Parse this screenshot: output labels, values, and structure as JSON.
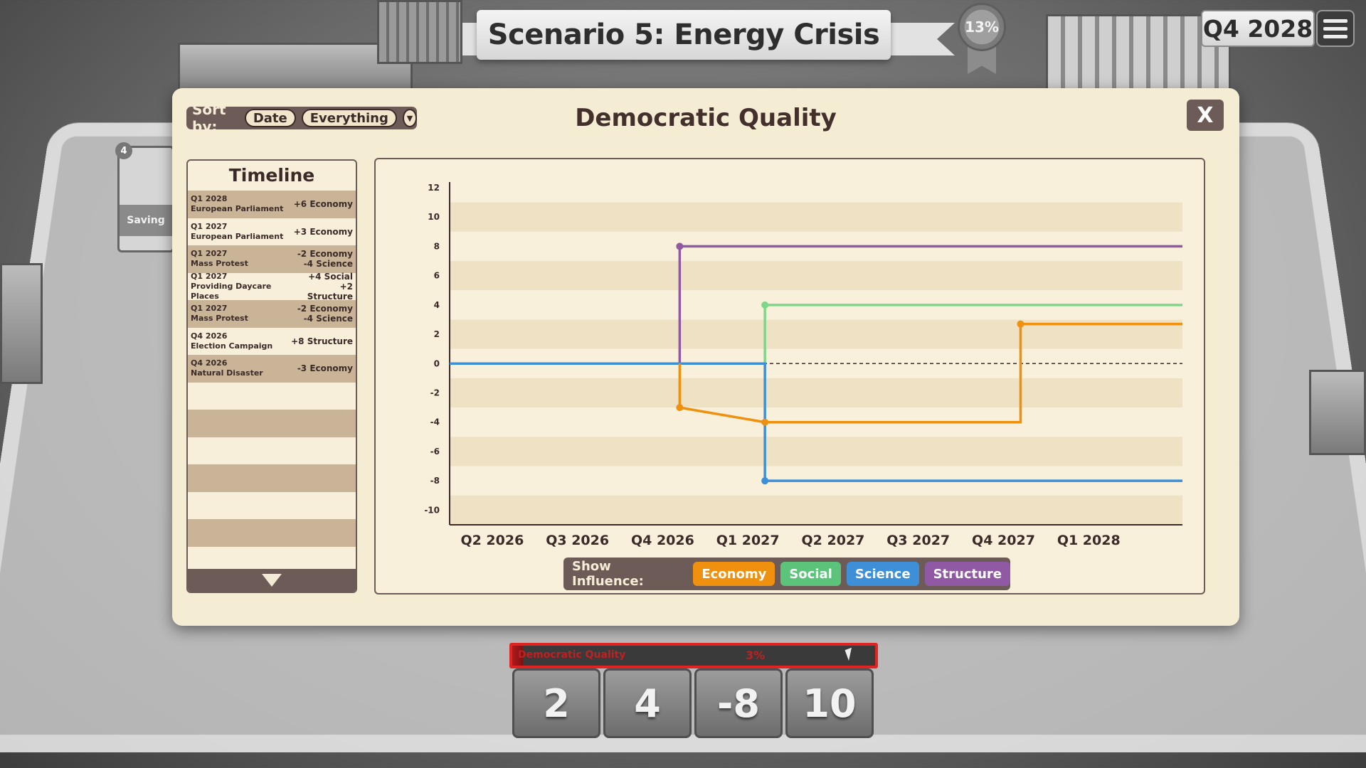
{
  "header": {
    "scenario_title": "Scenario 5: Energy Crisis",
    "progress_percent": "13%",
    "current_quarter": "Q4 2028"
  },
  "background": {
    "card_label": "Saving",
    "card_badge": "4"
  },
  "panel": {
    "title": "Democratic Quality",
    "sort_label": "Sort by:",
    "sort_primary": "Date",
    "sort_filter": "Everything",
    "close_label": "X"
  },
  "timeline": {
    "title": "Timeline",
    "entries": [
      {
        "quarter": "Q1 2028",
        "event": "European Parliament",
        "effect": "+6 Economy"
      },
      {
        "quarter": "Q1 2027",
        "event": "European Parliament",
        "effect": "+3 Economy"
      },
      {
        "quarter": "Q1 2027",
        "event": "Mass Protest",
        "effect": "-2 Economy\n-4 Science"
      },
      {
        "quarter": "Q1 2027",
        "event": "Providing Daycare Places",
        "effect": "+4 Social\n+2 Structure"
      },
      {
        "quarter": "Q1 2027",
        "event": "Mass Protest",
        "effect": "-2 Economy\n-4 Science"
      },
      {
        "quarter": "Q4 2026",
        "event": "Election Campaign",
        "effect": "+8 Structure"
      },
      {
        "quarter": "Q4 2026",
        "event": "Natural Disaster",
        "effect": "-3 Economy"
      }
    ]
  },
  "influence": {
    "label": "Show Influence:",
    "buttons": [
      {
        "label": "Economy",
        "color": "#f0900f"
      },
      {
        "label": "Social",
        "color": "#5cc47a"
      },
      {
        "label": "Science",
        "color": "#3d8fd8"
      },
      {
        "label": "Structure",
        "color": "#8f5aa3"
      }
    ]
  },
  "tracker": {
    "label": "Democratic Quality",
    "percent": "3%",
    "fill_fraction": 0.03
  },
  "dice": [
    "2",
    "4",
    "-8",
    "10"
  ],
  "chart_data": {
    "type": "line",
    "title": "Democratic Quality",
    "categories": [
      "Q2 2026",
      "Q3 2026",
      "Q4 2026",
      "Q1 2027",
      "Q2 2027",
      "Q3 2027",
      "Q4 2027",
      "Q1 2028"
    ],
    "yticks": [
      "12",
      "10",
      "8",
      "6",
      "4",
      "2",
      "0",
      "-2",
      "-4",
      "-6",
      "-8",
      "-10"
    ],
    "ylim": [
      -11,
      12
    ],
    "xlim": [
      1.5,
      10.1
    ],
    "grid": "horizontal bands",
    "zero_line": "dashed",
    "series": [
      {
        "name": "Structure",
        "color": "#8f5aa3",
        "points": [
          [
            1.5,
            0
          ],
          [
            4.2,
            0
          ],
          [
            4.2,
            8
          ],
          [
            10.1,
            8
          ]
        ],
        "markers": [
          [
            4.2,
            8
          ]
        ]
      },
      {
        "name": "Social",
        "color": "#7ed68a",
        "points": [
          [
            1.5,
            0
          ],
          [
            5.2,
            0
          ],
          [
            5.2,
            4
          ],
          [
            10.1,
            4
          ]
        ],
        "markers": [
          [
            5.2,
            4
          ]
        ]
      },
      {
        "name": "Science",
        "color": "#3d8fd8",
        "points": [
          [
            1.5,
            0
          ],
          [
            5.2,
            0
          ],
          [
            5.2,
            -8
          ],
          [
            10.1,
            -8
          ]
        ],
        "markers": [
          [
            5.2,
            -8
          ]
        ]
      },
      {
        "name": "Economy",
        "color": "#f0900f",
        "points": [
          [
            4.2,
            0
          ],
          [
            4.2,
            -3
          ],
          [
            5.2,
            -4
          ],
          [
            8.2,
            -4
          ],
          [
            8.2,
            2.7
          ],
          [
            10.1,
            2.7
          ]
        ],
        "markers": [
          [
            4.2,
            -3
          ],
          [
            5.2,
            -4
          ],
          [
            8.2,
            2.7
          ]
        ]
      }
    ]
  }
}
